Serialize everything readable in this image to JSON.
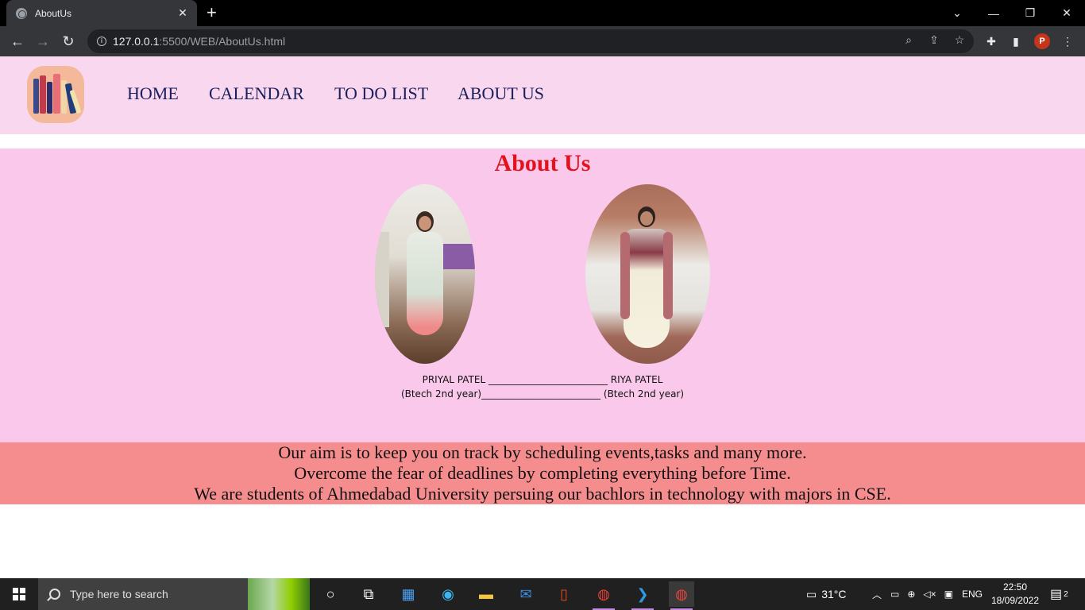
{
  "browser": {
    "tab_title": "AboutUs",
    "url_host": "127.0.0.1",
    "url_path": ":5500/WEB/AboutUs.html",
    "profile_initial": "P"
  },
  "nav": {
    "items": [
      {
        "label": "HOME"
      },
      {
        "label": "CALENDAR"
      },
      {
        "label": "TO DO LIST"
      },
      {
        "label": "ABOUT US"
      }
    ]
  },
  "about": {
    "title": "About Us",
    "caption_line1": "PRIYAL PATEL _________________________ RIYA PATEL",
    "caption_line2": "(Btech 2nd year)_________________________ (Btech 2nd year)"
  },
  "aim": {
    "lines": [
      "Our aim is to keep you on track by scheduling events,tasks and many more.",
      "Overcome the fear of deadlines by completing everything before Time.",
      "We are students of Ahmedabad University persuing our bachlors in technology with majors in CSE."
    ]
  },
  "taskbar": {
    "search_placeholder": "Type here to search",
    "temperature": "31°C",
    "language": "ENG",
    "time": "22:50",
    "date": "18/09/2022",
    "notification_count": "2"
  },
  "colors": {
    "navbar_bg": "#f9d7ee",
    "about_bg": "#f9c8ea",
    "title_red": "#e3121d",
    "aim_bg": "#f58d8f",
    "nav_text": "#1a1f5e"
  }
}
